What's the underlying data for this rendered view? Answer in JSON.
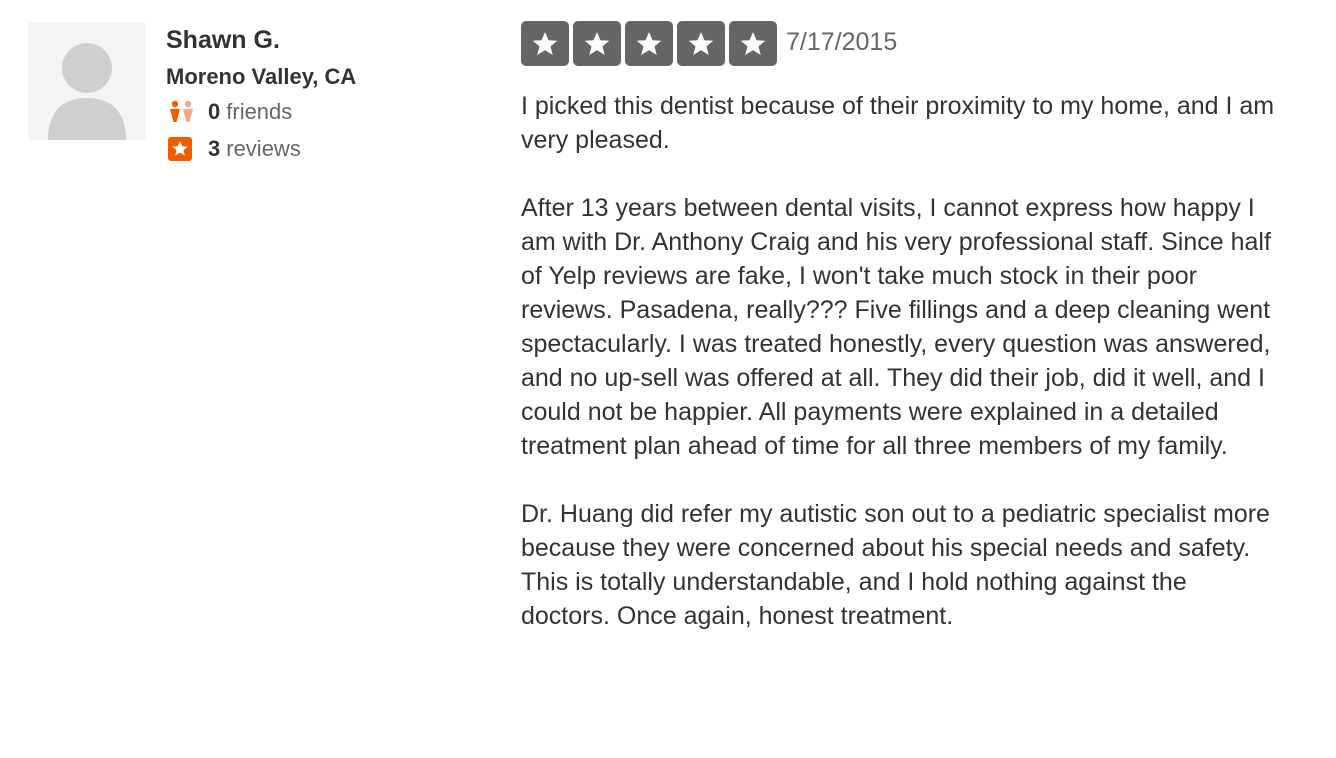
{
  "user": {
    "name": "Shawn G.",
    "location": "Moreno Valley, CA",
    "friends_count": "0",
    "friends_label": "friends",
    "reviews_count": "3",
    "reviews_label": "reviews",
    "avatar_icon": "default-user-silhouette-icon"
  },
  "review": {
    "rating": 5,
    "max_rating": 5,
    "date": "7/17/2015",
    "paragraphs": [
      "I picked this dentist because of their proximity to my home, and I am very pleased.",
      "After 13 years between dental visits, I cannot express how happy I am with Dr. Anthony Craig and his very professional staff. Since half of Yelp reviews are fake, I won't take much stock in their poor reviews. Pasadena, really??? Five fillings and a deep cleaning went spectacularly. I was treated honestly, every question was answered, and no up-sell was offered at all. They did their job, did it well, and I could not be happier. All payments were explained in a detailed treatment plan ahead of time for all three members of my family.",
      "Dr. Huang did refer my autistic son out to a pediatric specialist more because they were concerned about his special needs and safety. This is totally understandable, and I hold nothing against the doctors. Once again, honest treatment."
    ]
  },
  "colors": {
    "star_background": "#666666",
    "accent_orange": "#f15c00",
    "friends_icon_light": "#f6a98a",
    "text_dark": "#333333",
    "text_gray": "#666666"
  }
}
